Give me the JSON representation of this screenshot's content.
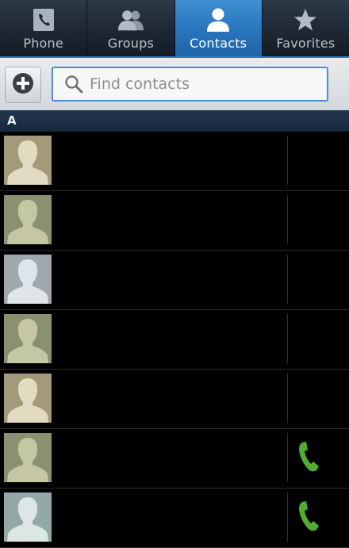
{
  "tabs": [
    {
      "label": "Phone",
      "icon": "phone-icon",
      "active": false
    },
    {
      "label": "Groups",
      "icon": "groups-icon",
      "active": false
    },
    {
      "label": "Contacts",
      "icon": "person-icon",
      "active": true
    },
    {
      "label": "Favorites",
      "icon": "star-icon",
      "active": false
    }
  ],
  "search": {
    "placeholder": "Find contacts",
    "value": "",
    "add_icon": "plus-circle-icon",
    "search_icon": "magnifier-icon"
  },
  "section": {
    "letter": "A"
  },
  "contacts": [
    {
      "avatar_bg": "#a39a79",
      "avatar_fg": "#e3dbc1",
      "has_call_button": false
    },
    {
      "avatar_bg": "#8a9170",
      "avatar_fg": "#c5c7a4",
      "has_call_button": false
    },
    {
      "avatar_bg": "#9fa8ad",
      "avatar_fg": "#dfe6ea",
      "has_call_button": false
    },
    {
      "avatar_bg": "#8a9170",
      "avatar_fg": "#c5c7a4",
      "has_call_button": false
    },
    {
      "avatar_bg": "#a39a79",
      "avatar_fg": "#e3dbc1",
      "has_call_button": false
    },
    {
      "avatar_bg": "#8a9170",
      "avatar_fg": "#c5c7a4",
      "has_call_button": true
    },
    {
      "avatar_bg": "#94a8a9",
      "avatar_fg": "#dbe6e5",
      "has_call_button": true
    }
  ],
  "colors": {
    "accent": "#2a76bf",
    "call_green": "#4fae2f",
    "tab_inactive_text": "#b9c1ca"
  }
}
